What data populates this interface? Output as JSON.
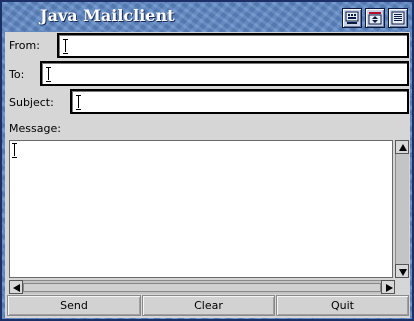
{
  "window": {
    "title": "Java Mailclient"
  },
  "titlebar_icons": [
    "iconify-icon",
    "depth-icon",
    "zoom-icon"
  ],
  "form": {
    "from_label": "From:",
    "from_value": "",
    "to_label": "To:",
    "to_value": "",
    "subject_label": "Subject:",
    "subject_value": "",
    "message_label": "Message:",
    "message_value": ""
  },
  "buttons": {
    "send": "Send",
    "clear": "Clear",
    "quit": "Quit"
  },
  "colors": {
    "desktop": "#5b85c2",
    "panel": "#d6d6d6",
    "title_text": "#ffffff"
  }
}
